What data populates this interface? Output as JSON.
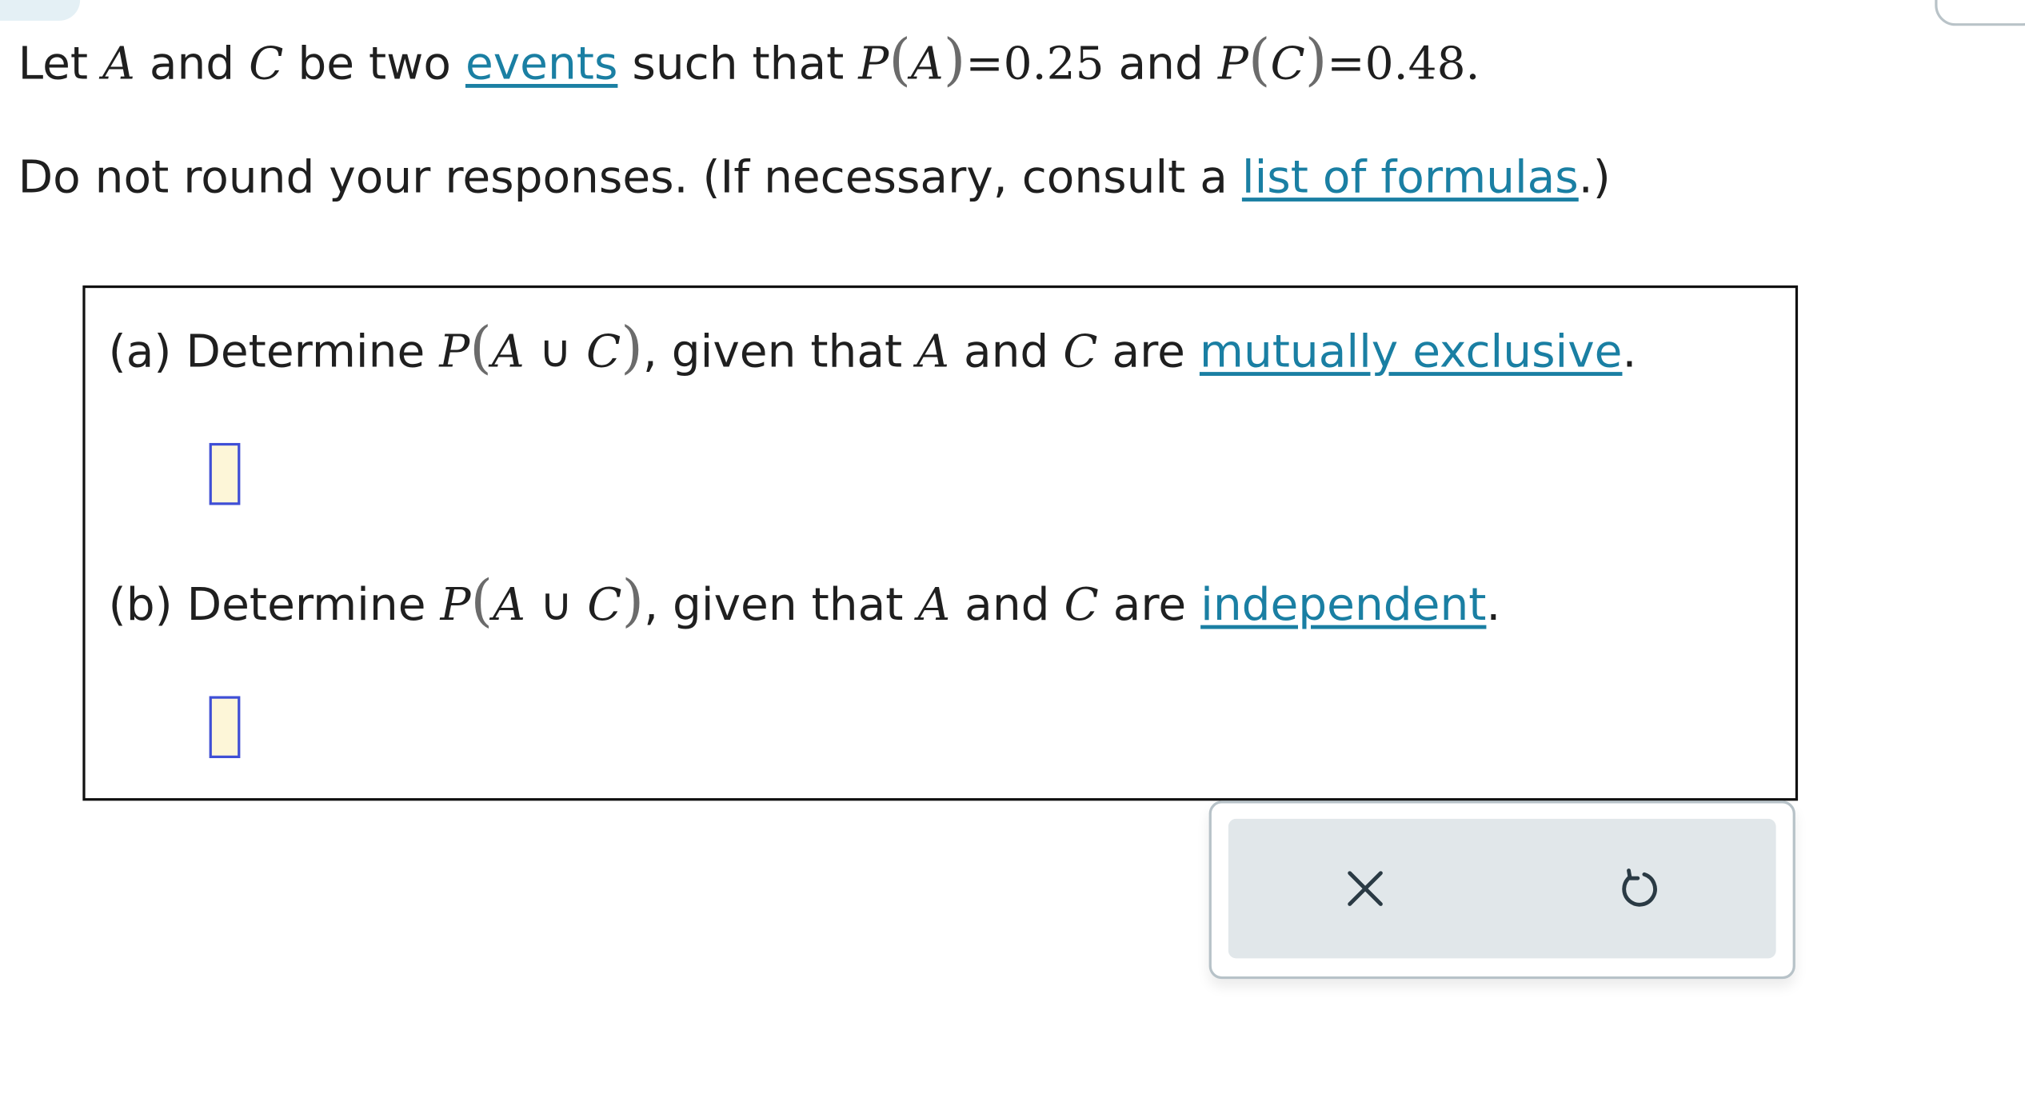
{
  "intro": {
    "p1": "Let ",
    "A": "A",
    "p2": " and ",
    "C": "C",
    "p3": " be two ",
    "events_link": "events",
    "p4": " such that ",
    "P1": "P",
    "A2": "A",
    "eq1": "=0.25",
    "p5": " and ",
    "P2": "P",
    "C2": "C",
    "eq2": "=0.48",
    "period": "."
  },
  "instructions": {
    "p1": "Do not round your responses. (If necessary, consult a ",
    "formulas_link": "list of formulas",
    "p2": ".)"
  },
  "question_a": {
    "label": "(a)",
    "p1": " Determine ",
    "P": "P",
    "A": "A",
    "union": " ∪ ",
    "C": "C",
    "p2": ", given that ",
    "A2": "A",
    "p3": " and ",
    "C2": "C",
    "p4": " are ",
    "link": "mutually exclusive",
    "period": ".",
    "answer_value": ""
  },
  "question_b": {
    "label": "(b)",
    "p1": " Determine ",
    "P": "P",
    "A": "A",
    "union": " ∪ ",
    "C": "C",
    "p2": ", given that ",
    "A2": "A",
    "p3": " and ",
    "C2": "C",
    "p4": " are ",
    "link": "independent",
    "period": ".",
    "answer_value": ""
  },
  "toolbar": {
    "clear_icon": "close-icon",
    "undo_icon": "undo-icon"
  },
  "colors": {
    "link": "#1a7fa3",
    "answer_border": "#3f4fd6",
    "answer_fill": "#fdf6d8",
    "toolbar_bg": "#e1e7ea"
  }
}
